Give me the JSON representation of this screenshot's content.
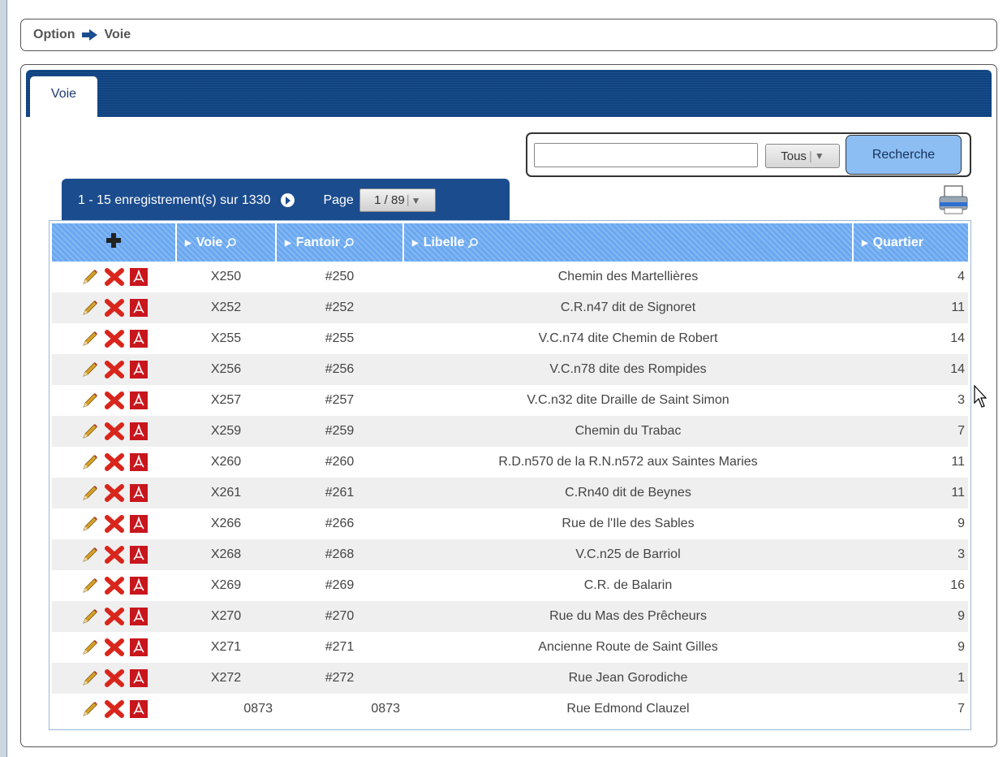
{
  "breadcrumb": {
    "root": "Option",
    "current": "Voie"
  },
  "tabs": [
    {
      "label": "Voie"
    }
  ],
  "search": {
    "value": "",
    "placeholder": "",
    "filter_value": "Tous",
    "button_label": "Recherche"
  },
  "pager": {
    "summary": "1 - 15 enregistrement(s) sur 1330",
    "page_label": "Page",
    "page_value": "1 / 89"
  },
  "table": {
    "columns": [
      "Voie",
      "Fantoir",
      "Libelle",
      "Quartier"
    ],
    "rows": [
      {
        "voie": "X250",
        "fantoir": "#250",
        "libelle": "Chemin des Martellières",
        "quartier": "4"
      },
      {
        "voie": "X252",
        "fantoir": "#252",
        "libelle": "C.R.n47 dit de Signoret",
        "quartier": "11"
      },
      {
        "voie": "X255",
        "fantoir": "#255",
        "libelle": "V.C.n74 dite Chemin de Robert",
        "quartier": "14"
      },
      {
        "voie": "X256",
        "fantoir": "#256",
        "libelle": "V.C.n78 dite des Rompides",
        "quartier": "14"
      },
      {
        "voie": "X257",
        "fantoir": "#257",
        "libelle": "V.C.n32 dite Draille de Saint Simon",
        "quartier": "3"
      },
      {
        "voie": "X259",
        "fantoir": "#259",
        "libelle": "Chemin du Trabac",
        "quartier": "7"
      },
      {
        "voie": "X260",
        "fantoir": "#260",
        "libelle": "R.D.n570 de la R.N.n572 aux Saintes Maries",
        "quartier": "11"
      },
      {
        "voie": "X261",
        "fantoir": "#261",
        "libelle": "C.Rn40 dit de Beynes",
        "quartier": "11"
      },
      {
        "voie": "X266",
        "fantoir": "#266",
        "libelle": "Rue de l'Ile des Sables",
        "quartier": "9"
      },
      {
        "voie": "X268",
        "fantoir": "#268",
        "libelle": "V.C.n25 de Barriol",
        "quartier": "3"
      },
      {
        "voie": "X269",
        "fantoir": "#269",
        "libelle": "C.R. de Balarin",
        "quartier": "16"
      },
      {
        "voie": "X270",
        "fantoir": "#270",
        "libelle": "Rue du Mas des Prêcheurs",
        "quartier": "9"
      },
      {
        "voie": "X271",
        "fantoir": "#271",
        "libelle": "Ancienne Route de Saint Gilles",
        "quartier": "9"
      },
      {
        "voie": "X272",
        "fantoir": "#272",
        "libelle": "Rue Jean Gorodiche",
        "quartier": "1"
      },
      {
        "voie": "0873",
        "fantoir": "0873",
        "libelle": "Rue Edmond Clauzel",
        "quartier": "7"
      }
    ]
  },
  "icons": {
    "arrow": "arrow-right-icon",
    "next": "next-page-icon",
    "add": "plus-icon",
    "search": "magnifier-icon",
    "edit": "pencil-icon",
    "delete": "delete-x-icon",
    "pdf": "pdf-icon",
    "print": "printer-icon"
  },
  "colors": {
    "header_blue": "#0f4381",
    "pager_blue": "#1b4c8e",
    "column_header": "#6aa8f0",
    "button_blue": "#8dbef3",
    "delete_red": "#d9261c",
    "pdf_red": "#c8161d"
  }
}
